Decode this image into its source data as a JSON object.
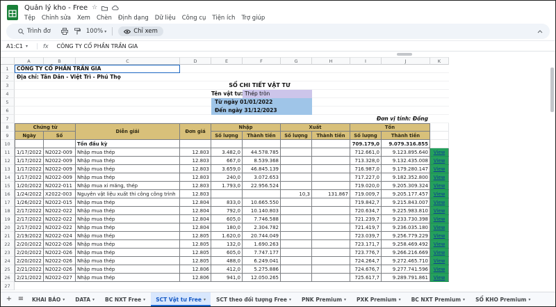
{
  "titlebar": {
    "title": "Quản lý kho - Free",
    "menus": [
      "Tệp",
      "Chỉnh sửa",
      "Xem",
      "Chèn",
      "Định dạng",
      "Dữ liệu",
      "Công cụ",
      "Tiện ích",
      "Trợ giúp"
    ]
  },
  "toolbar": {
    "menus_button": "Trình đơ",
    "zoom": "100%",
    "view_only": "Chỉ xem"
  },
  "formula_bar": {
    "cell_ref": "A1:C1",
    "fx": "fx",
    "value": "CÔNG TY CỔ PHẦN TRẦN GIA"
  },
  "sheet": {
    "columns": [
      "A",
      "B",
      "C",
      "D",
      "E",
      "F",
      "G",
      "H",
      "I",
      "J",
      "K"
    ],
    "company": "CÔNG TY CỔ PHẦN TRẦN GIA",
    "address": "Địa chỉ: Tân Dân - Việt Trì - Phú Thọ",
    "report_title": "SỔ CHI TIẾT VẬT TƯ",
    "material_label": "Tên vật tư:",
    "material_value": "Thép tròn",
    "from_date": "Từ ngày 01/01/2022",
    "to_date": "Đến ngày 31/12/2023",
    "unit_note": "Đơn vị tính: Đồng",
    "header": {
      "chung_tu": "Chứng từ",
      "ngay": "Ngày",
      "so": "Số",
      "dien_giai": "Diễn giải",
      "don_gia": "Đơn giá",
      "nhap": "Nhập",
      "xuat": "Xuất",
      "ton": "Tồn",
      "so_luong": "Số lượng",
      "thanh_tien": "Thành tiền"
    },
    "opening": {
      "label": "Tồn đầu kỳ",
      "ton_sl": "709.179,0",
      "ton_tt": "9.079.316.855"
    },
    "rows": [
      {
        "date": "1/17/2022",
        "so": "N2022-009",
        "desc": "Nhập mua thép",
        "price": "12.803",
        "in_qty": "3.482,0",
        "in_amt": "44.578.785",
        "out_qty": "",
        "out_amt": "",
        "bal_qty": "712.661,0",
        "bal_amt": "9.123.895.640",
        "link": "View"
      },
      {
        "date": "1/17/2022",
        "so": "N2022-009",
        "desc": "Nhập mua thép",
        "price": "12.803",
        "in_qty": "667,0",
        "in_amt": "8.539.368",
        "out_qty": "",
        "out_amt": "",
        "bal_qty": "713.328,0",
        "bal_amt": "9.132.435.008",
        "link": "View"
      },
      {
        "date": "1/17/2022",
        "so": "N2022-009",
        "desc": "Nhập mua thép",
        "price": "12.803",
        "in_qty": "3.659,0",
        "in_amt": "46.845.139",
        "out_qty": "",
        "out_amt": "",
        "bal_qty": "716.987,0",
        "bal_amt": "9.179.280.147",
        "link": "View"
      },
      {
        "date": "1/17/2022",
        "so": "N2022-009",
        "desc": "Nhập mua thép",
        "price": "12.803",
        "in_qty": "240,0",
        "in_amt": "3.072.653",
        "out_qty": "",
        "out_amt": "",
        "bal_qty": "717.227,0",
        "bal_amt": "9.182.352.800",
        "link": "View"
      },
      {
        "date": "1/20/2022",
        "so": "N2022-011",
        "desc": "Nhập mua xi măng, thép",
        "price": "12.803",
        "in_qty": "1.793,0",
        "in_amt": "22.956.524",
        "out_qty": "",
        "out_amt": "",
        "bal_qty": "719.020,0",
        "bal_amt": "9.205.309.324",
        "link": "View"
      },
      {
        "date": "1/24/2022",
        "so": "X2022-003",
        "desc": "Nguyên vật liệu xuất thi công công trình",
        "price": "12.803",
        "in_qty": "",
        "in_amt": "",
        "out_qty": "10,3",
        "out_amt": "131.867",
        "bal_qty": "719.009,7",
        "bal_amt": "9.205.177.457",
        "link": "View"
      },
      {
        "date": "1/26/2022",
        "so": "N2022-015",
        "desc": "Nhập mua thép",
        "price": "12.804",
        "in_qty": "833,0",
        "in_amt": "10.665.550",
        "out_qty": "",
        "out_amt": "",
        "bal_qty": "719.842,7",
        "bal_amt": "9.215.843.007",
        "link": "View"
      },
      {
        "date": "2/17/2022",
        "so": "N2022-022",
        "desc": "Nhập mua thép",
        "price": "12.804",
        "in_qty": "792,0",
        "in_amt": "10.140.803",
        "out_qty": "",
        "out_amt": "",
        "bal_qty": "720.634,7",
        "bal_amt": "9.225.983.810",
        "link": "View"
      },
      {
        "date": "2/17/2022",
        "so": "N2022-022",
        "desc": "Nhập mua thép",
        "price": "12.804",
        "in_qty": "605,0",
        "in_amt": "7.746.588",
        "out_qty": "",
        "out_amt": "",
        "bal_qty": "721.239,7",
        "bal_amt": "9.233.730.398",
        "link": "View"
      },
      {
        "date": "2/17/2022",
        "so": "N2022-022",
        "desc": "Nhập mua thép",
        "price": "12.804",
        "in_qty": "180,0",
        "in_amt": "2.304.782",
        "out_qty": "",
        "out_amt": "",
        "bal_qty": "721.419,7",
        "bal_amt": "9.236.035.180",
        "link": "View"
      },
      {
        "date": "2/19/2022",
        "so": "N2022-024",
        "desc": "Nhập mua thép",
        "price": "12.805",
        "in_qty": "1.620,0",
        "in_amt": "20.744.049",
        "out_qty": "",
        "out_amt": "",
        "bal_qty": "723.039,7",
        "bal_amt": "9.256.779.229",
        "link": "View"
      },
      {
        "date": "2/20/2022",
        "so": "N2022-026",
        "desc": "Nhập mua thép",
        "price": "12.805",
        "in_qty": "132,0",
        "in_amt": "1.690.263",
        "out_qty": "",
        "out_amt": "",
        "bal_qty": "723.171,7",
        "bal_amt": "9.258.469.492",
        "link": "View"
      },
      {
        "date": "2/20/2022",
        "so": "N2022-026",
        "desc": "Nhập mua thép",
        "price": "12.805",
        "in_qty": "605,0",
        "in_amt": "7.747.177",
        "out_qty": "",
        "out_amt": "",
        "bal_qty": "723.776,7",
        "bal_amt": "9.266.216.669",
        "link": "View"
      },
      {
        "date": "2/20/2022",
        "so": "N2022-026",
        "desc": "Nhập mua thép",
        "price": "12.805",
        "in_qty": "488,0",
        "in_amt": "6.249.041",
        "out_qty": "",
        "out_amt": "",
        "bal_qty": "724.264,7",
        "bal_amt": "9.272.465.710",
        "link": "View"
      },
      {
        "date": "2/21/2022",
        "so": "N2022-026",
        "desc": "Nhập mua thép",
        "price": "12.806",
        "in_qty": "412,0",
        "in_amt": "5.275.886",
        "out_qty": "",
        "out_amt": "",
        "bal_qty": "724.676,7",
        "bal_amt": "9.277.741.596",
        "link": "View"
      },
      {
        "date": "2/21/2022",
        "so": "N2022-027",
        "desc": "Nhập mua thép",
        "price": "12.806",
        "in_qty": "941,0",
        "in_amt": "12.050.265",
        "out_qty": "",
        "out_amt": "",
        "bal_qty": "725.617,7",
        "bal_amt": "9.289.791.861",
        "link": "View"
      }
    ]
  },
  "tabbar": {
    "tabs": [
      "KHAI BÁO",
      "DATA",
      "BC NXT Free",
      "SCT Vật tư Free",
      "SCT theo đối tượng Free",
      "PNK Premium",
      "PXK Premium",
      "BC NXT Premium",
      "SỔ KHO Premium"
    ],
    "active_index": 3
  },
  "colors": {
    "headerbg": "#d8c07a",
    "lavender": "#ccc5ea",
    "lightblue": "#9fc5e8",
    "viewgreen": "#24a05c",
    "activetab": "#1a67d2",
    "logo_green": "#188038"
  }
}
